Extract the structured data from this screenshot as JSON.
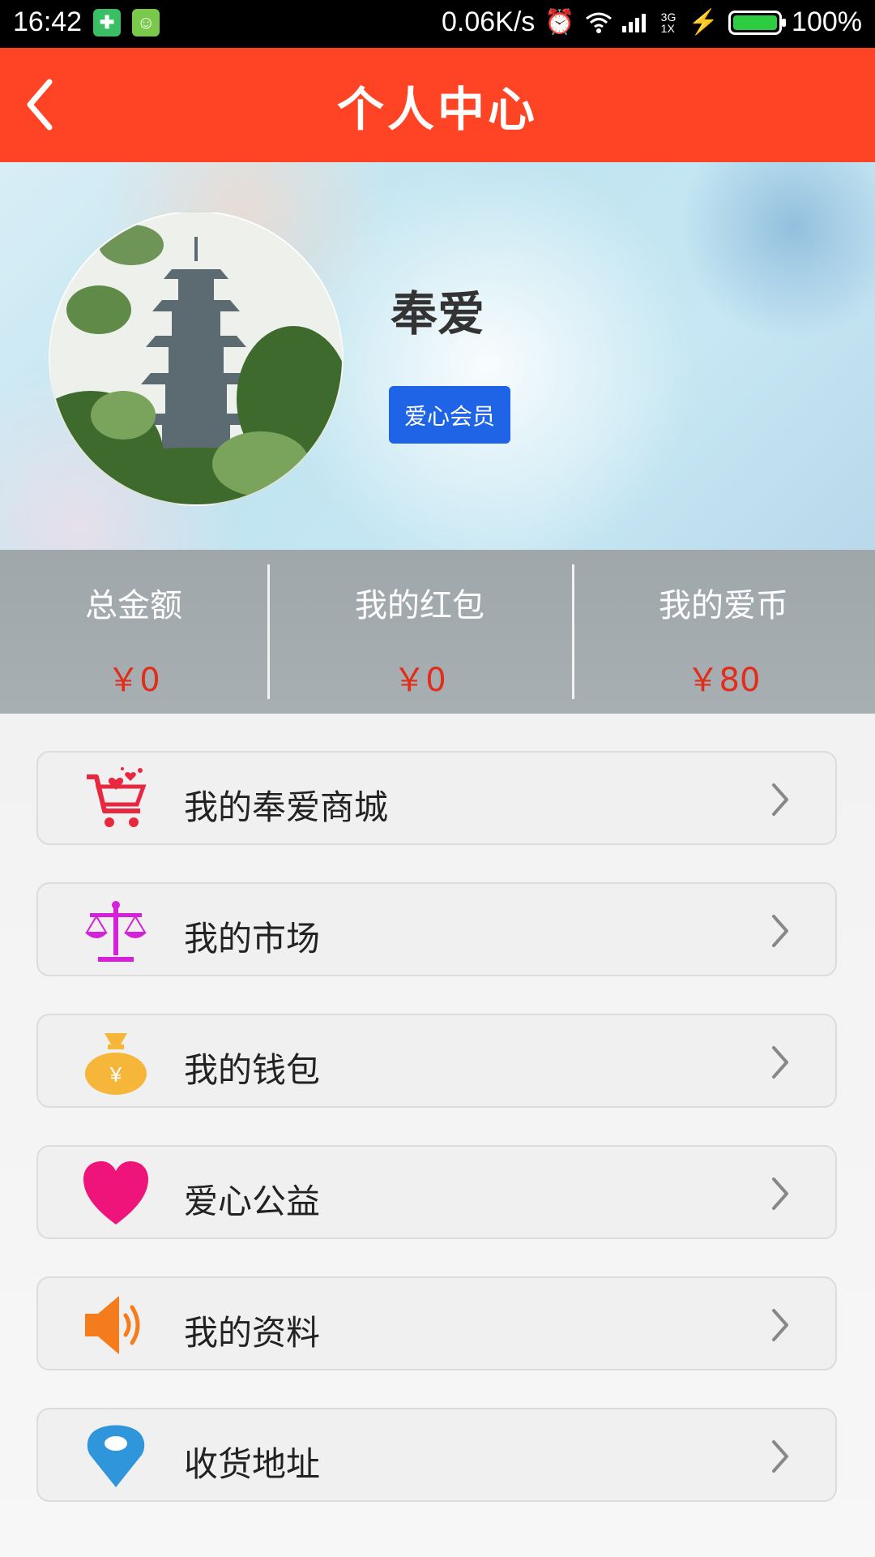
{
  "status_bar": {
    "time": "16:42",
    "speed": "0.06K/s",
    "signal": "3G 1X",
    "battery": "100%"
  },
  "header": {
    "title": "个人中心",
    "back_icon": "chevron-left-icon"
  },
  "profile": {
    "name": "奉爱",
    "badge": "爱心会员"
  },
  "stats": [
    {
      "label": "总金额",
      "value": "￥0"
    },
    {
      "label": "我的红包",
      "value": "￥0"
    },
    {
      "label": "我的爱币",
      "value": "￥80"
    }
  ],
  "menu": [
    {
      "label": "我的奉爱商城",
      "icon": "shopping-cart-icon",
      "color": "#e8283f"
    },
    {
      "label": "我的市场",
      "icon": "scale-icon",
      "color": "#d522d8"
    },
    {
      "label": "我的钱包",
      "icon": "money-bag-icon",
      "color": "#f5b63a"
    },
    {
      "label": "爱心公益",
      "icon": "heart-icon",
      "color": "#ee1479"
    },
    {
      "label": "我的资料",
      "icon": "speaker-icon",
      "color": "#f57c1c"
    },
    {
      "label": "收货地址",
      "icon": "location-pin-icon",
      "color": "#2f96dc"
    }
  ],
  "colors": {
    "header": "#ff4426",
    "badge": "#1f63e6",
    "stat_value": "#e12d1a"
  }
}
